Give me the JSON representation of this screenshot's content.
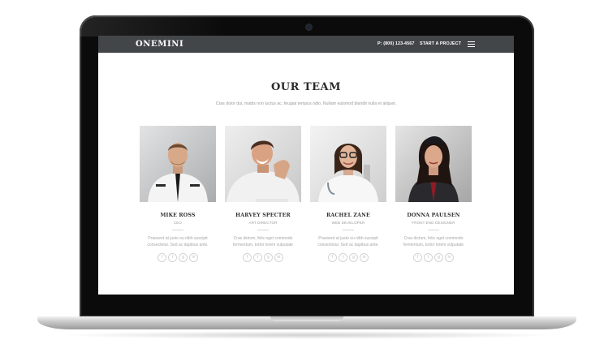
{
  "navbar": {
    "logo": "ONEMINI",
    "phone": "P: (800) 123-4567",
    "cta": "START A PROJECT"
  },
  "section": {
    "title": "OUR TEAM",
    "subtitle": "Cras dolor dui, mattis non luctus ac, feugiat tempus odio. Nullam euismod blandit nulla et aliquet."
  },
  "team": [
    {
      "name": "MIKE ROSS",
      "role": "CEO",
      "bio": "Praesent at justo eu nibh suscipit consectetur. Sed ac dapibus ante."
    },
    {
      "name": "HARVEY SPECTER",
      "role": "ART DIRECTOR",
      "bio": "Cras dictum, felis eget commodo fermentum, tortor lorem vulputate"
    },
    {
      "name": "RACHEL ZANE",
      "role": "WEB DEVELOPER",
      "bio": "Praesent at justo eu nibh suscipit consectetur. Sed ac dapibus ante."
    },
    {
      "name": "DONNA PAULSEN",
      "role": "FRONT END DESIGNER",
      "bio": "Cras dictum, felis eget commodo fermentum, tortor lorem vulputate"
    }
  ],
  "social_icons": [
    "facebook-icon",
    "twitter-icon",
    "google-plus-icon",
    "linkedin-icon"
  ],
  "social_glyphs": [
    "f",
    "t",
    "g",
    "in"
  ],
  "colors": {
    "navbar": "#434649",
    "title": "#2b2b2b",
    "muted": "#9a9a9a"
  }
}
